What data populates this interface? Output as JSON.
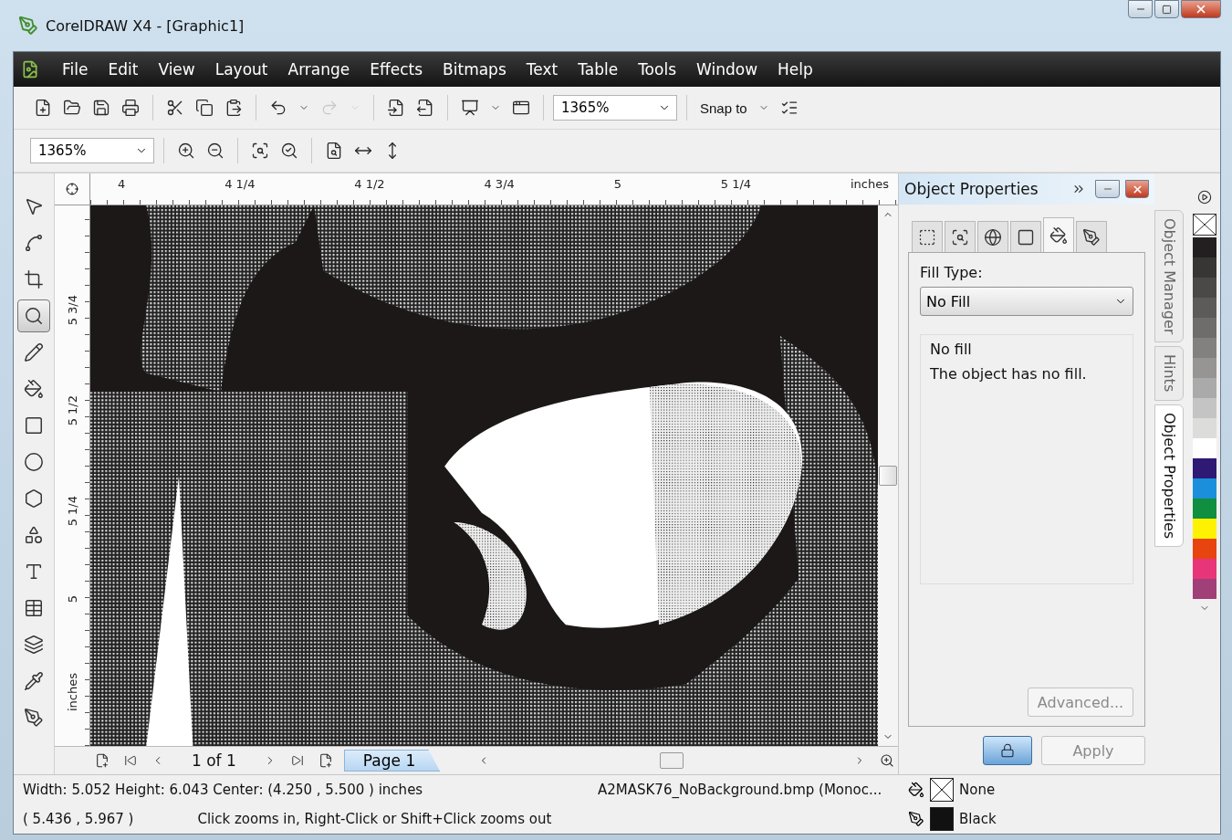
{
  "window": {
    "title": "CorelDRAW X4 - [Graphic1]"
  },
  "menu": [
    "File",
    "Edit",
    "View",
    "Layout",
    "Arrange",
    "Effects",
    "Bitmaps",
    "Text",
    "Table",
    "Tools",
    "Window",
    "Help"
  ],
  "standard_toolbar": {
    "buttons": [
      {
        "kind": "new",
        "disabled": false
      },
      {
        "kind": "open",
        "disabled": false
      },
      {
        "kind": "save",
        "disabled": false
      },
      {
        "kind": "print",
        "disabled": false
      },
      {
        "kind": "sep",
        "disabled": false
      },
      {
        "kind": "cut",
        "disabled": false
      },
      {
        "kind": "copy",
        "disabled": false
      },
      {
        "kind": "paste",
        "disabled": false
      },
      {
        "kind": "sep",
        "disabled": false
      },
      {
        "kind": "undo",
        "disabled": false
      },
      {
        "kind": "caret",
        "disabled": false
      },
      {
        "kind": "redo",
        "disabled": true
      },
      {
        "kind": "caret",
        "disabled": true
      },
      {
        "kind": "sep",
        "disabled": false
      },
      {
        "kind": "import",
        "disabled": false
      },
      {
        "kind": "export",
        "disabled": false
      },
      {
        "kind": "sep",
        "disabled": false
      },
      {
        "kind": "publish",
        "disabled": false
      },
      {
        "kind": "caret",
        "disabled": false
      },
      {
        "kind": "launcher",
        "disabled": false
      }
    ],
    "zoom_level": "1365%",
    "snap_to": "Snap to"
  },
  "zoom_toolbar": {
    "zoom_level": "1365%",
    "buttons": [
      {
        "kind": "zoom_in"
      },
      {
        "kind": "zoom_out"
      },
      {
        "kind": "sep"
      },
      {
        "kind": "zoom_selected"
      },
      {
        "kind": "zoom_all"
      },
      {
        "kind": "sep"
      },
      {
        "kind": "zoom_page"
      },
      {
        "kind": "zoom_width"
      },
      {
        "kind": "zoom_height"
      }
    ]
  },
  "toolbox": [
    {
      "kind": "pick",
      "selected": false
    },
    {
      "kind": "shape",
      "selected": false
    },
    {
      "kind": "crop",
      "selected": false
    },
    {
      "kind": "zoom",
      "selected": true
    },
    {
      "kind": "freehand",
      "selected": false
    },
    {
      "kind": "smart_fill",
      "selected": false
    },
    {
      "kind": "rectangle",
      "selected": false
    },
    {
      "kind": "ellipse",
      "selected": false
    },
    {
      "kind": "polygon",
      "selected": false
    },
    {
      "kind": "basic_shapes",
      "selected": false
    },
    {
      "kind": "text",
      "selected": false
    },
    {
      "kind": "table",
      "selected": false
    },
    {
      "kind": "blend",
      "selected": false
    },
    {
      "kind": "eyedropper",
      "selected": false
    },
    {
      "kind": "outline",
      "selected": false
    }
  ],
  "horizontal_ruler": {
    "labels": [
      "4",
      "4 1/4",
      "4 1/2",
      "4 3/4",
      "5",
      "5 1/4"
    ],
    "unit": "inches"
  },
  "vertical_ruler": {
    "labels": [
      "5 3/4",
      "5 1/2",
      "5 1/4",
      "5"
    ],
    "unit": "inches"
  },
  "page_navigator": {
    "count": "1 of 1",
    "pages": [
      {
        "label": "Page 1",
        "selected": true
      }
    ]
  },
  "docker": {
    "title": "Object Properties",
    "tabs": [
      {
        "kind": "outline_frame",
        "selected": false
      },
      {
        "kind": "zoom_frame",
        "selected": false
      },
      {
        "kind": "internet",
        "selected": false
      },
      {
        "kind": "frame",
        "selected": false
      },
      {
        "kind": "fill",
        "selected": true
      },
      {
        "kind": "pen",
        "selected": false
      }
    ],
    "fill_type_label": "Fill Type:",
    "fill_type": "No Fill",
    "group_title": "No fill",
    "description": "The object has no fill.",
    "advanced_button": {
      "label": "Advanced...",
      "disabled": true
    },
    "apply_button": {
      "label": "Apply",
      "disabled": true
    }
  },
  "side_tabs": [
    {
      "label": "Object Manager",
      "selected": false
    },
    {
      "label": "Hints",
      "selected": false
    },
    {
      "label": "Object Properties",
      "selected": true
    }
  ],
  "palette": [
    {
      "color": "#231f20"
    },
    {
      "color": "#383634"
    },
    {
      "color": "#4b4947"
    },
    {
      "color": "#5d5b59"
    },
    {
      "color": "#6e6d6b"
    },
    {
      "color": "#828180"
    },
    {
      "color": "#969594"
    },
    {
      "color": "#abaaaa"
    },
    {
      "color": "#c4c4c4"
    },
    {
      "color": "#dcdcdb"
    },
    {
      "color": "#ffffff"
    },
    {
      "color": "#2e1a74"
    },
    {
      "color": "#1b8fdc"
    },
    {
      "color": "#0f8f3f"
    },
    {
      "color": "#fff200"
    },
    {
      "color": "#e8440f"
    },
    {
      "color": "#e8357a"
    },
    {
      "color": "#a03f78"
    }
  ],
  "status_bar": {
    "dimensions": "Width: 5.052  Height: 6.043  Center: (4.250 , 5.500 ) inches",
    "file": "A2MASK76_NoBackground.bmp (Monoc...",
    "fill": "None",
    "cursor": "( 5.436 , 5.967 )",
    "hint": "Click zooms in, Right-Click or Shift+Click zooms out",
    "outline": "Black"
  }
}
